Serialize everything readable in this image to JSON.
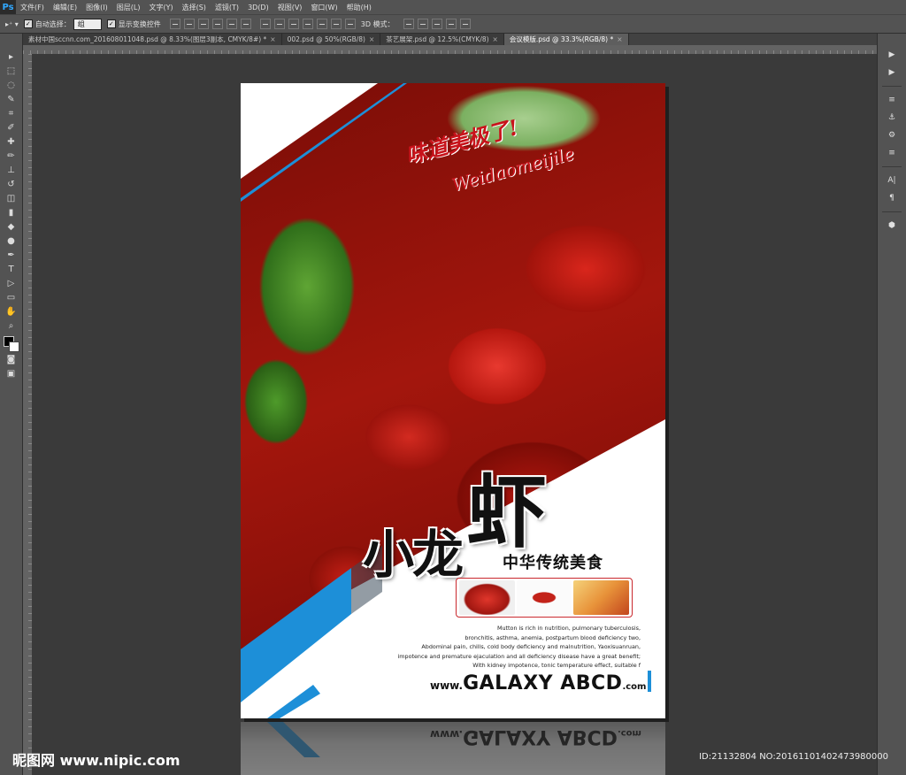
{
  "app": {
    "logo": "Ps"
  },
  "menu": [
    "文件(F)",
    "编辑(E)",
    "图像(I)",
    "图层(L)",
    "文字(Y)",
    "选择(S)",
    "滤镜(T)",
    "3D(D)",
    "视图(V)",
    "窗口(W)",
    "帮助(H)"
  ],
  "options": {
    "auto_select_label": "自动选择：",
    "auto_select_value": "组",
    "show_transform_label": "显示变换控件",
    "mode_3d_label": "3D 模式："
  },
  "tabs": [
    {
      "label": "素材中国sccnn.com_20160801104​8.psd @ 8.33%(图层3副本, CMYK/8#) *",
      "active": false
    },
    {
      "label": "002.psd @ 50%(RGB/8)",
      "active": false
    },
    {
      "label": "茶艺展架.psd @ 12.5%(CMYK/8)",
      "active": false
    },
    {
      "label": "会议模版.psd @ 33.3%(RGB/8) *",
      "active": true
    }
  ],
  "tools": [
    "move-icon",
    "marquee-icon",
    "lasso-icon",
    "quick-select-icon",
    "crop-icon",
    "eyedropper-icon",
    "healing-icon",
    "brush-icon",
    "stamp-icon",
    "history-brush-icon",
    "eraser-icon",
    "gradient-icon",
    "blur-icon",
    "dodge-icon",
    "pen-icon",
    "type-icon",
    "path-select-icon",
    "shape-icon",
    "hand-icon",
    "zoom-icon"
  ],
  "tool_glyphs": [
    "▸",
    "⬚",
    "◌",
    "✎",
    "⌗",
    "✐",
    "✚",
    "✏",
    "⊥",
    "↺",
    "◫",
    "▮",
    "◆",
    "●",
    "✒",
    "T",
    "▷",
    "▭",
    "✋",
    "⌕"
  ],
  "right_panel_glyphs": [
    "▶",
    "▶",
    "≡",
    "⚓",
    "⚙",
    "≡",
    "A|",
    "¶",
    "⬢"
  ],
  "poster": {
    "script_cn": "味道美极了!",
    "script_en": "Weidaomeijile",
    "title_small": "小龙",
    "title_big": "虾",
    "subtitle": "中华传统美食",
    "body_lines": [
      "Mutton is rich in nutrition, pulmonary tuberculosis,",
      "bronchitis, asthma, anemia, postpartum blood deficiency two,",
      "Abdominal pain, chills, cold body deficiency and malnutrition, Yaoxisuanruan,",
      "impotence and premature ejaculation and all deficiency disease have a great benefit;",
      "With kidney impotence, tonic temperature effect, suitable f"
    ],
    "brand_pre": "www.",
    "brand_mid": "GALAXY ABCD",
    "brand_post": ".com"
  },
  "watermark": {
    "left": "昵图网 www.nipic.com",
    "right": "ID:21132804 NO:20161101402473980000"
  },
  "colors": {
    "accent_blue": "#1d8fd8",
    "script_red": "#c8131b",
    "ps_blue": "#31a8ff"
  }
}
